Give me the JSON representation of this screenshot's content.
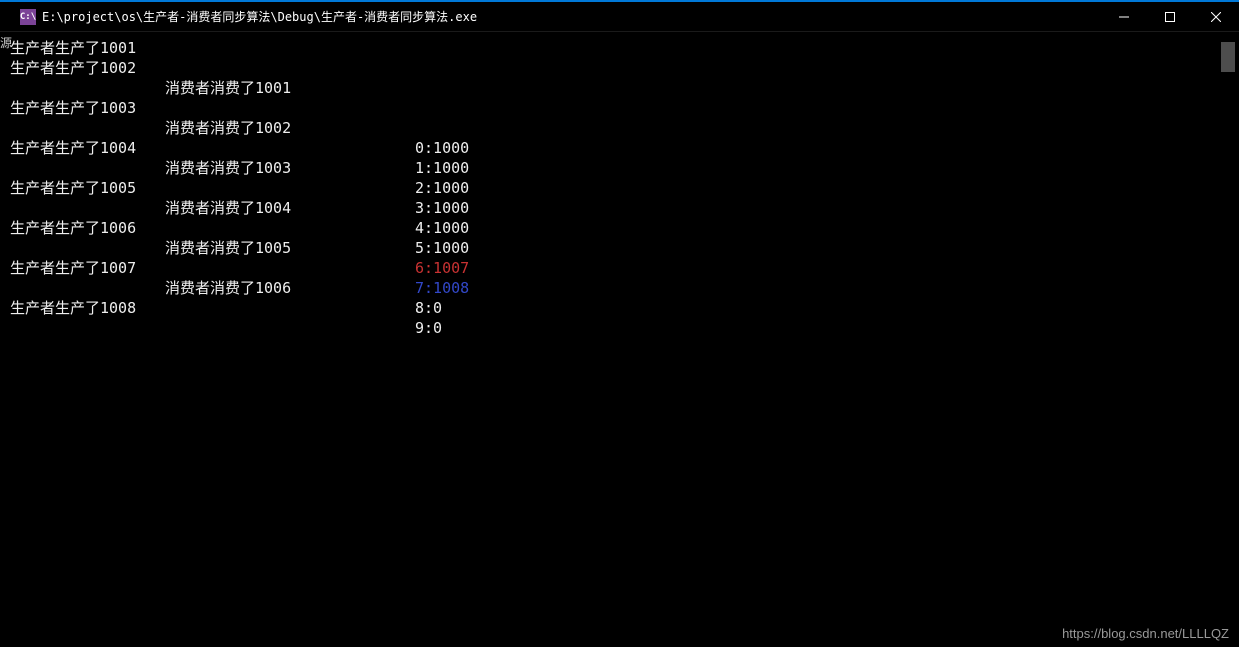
{
  "left_tab": "源",
  "titlebar": {
    "icon_label": "C:\\",
    "title": "E:\\project\\os\\生产者-消费者同步算法\\Debug\\生产者-消费者同步算法.exe"
  },
  "rows": [
    {
      "prod": "生产者生产了1001",
      "cons": "",
      "buf": "",
      "buf_class": ""
    },
    {
      "prod": "生产者生产了1002",
      "cons": "",
      "buf": "",
      "buf_class": ""
    },
    {
      "prod": "",
      "cons": "消费者消费了1001",
      "buf": "",
      "buf_class": ""
    },
    {
      "prod": "生产者生产了1003",
      "cons": "",
      "buf": "",
      "buf_class": ""
    },
    {
      "prod": "",
      "cons": "消费者消费了1002",
      "buf": "",
      "buf_class": ""
    },
    {
      "prod": "生产者生产了1004",
      "cons": "",
      "buf": "0:1000",
      "buf_class": ""
    },
    {
      "prod": "",
      "cons": "消费者消费了1003",
      "buf": "1:1000",
      "buf_class": ""
    },
    {
      "prod": "生产者生产了1005",
      "cons": "",
      "buf": "2:1000",
      "buf_class": ""
    },
    {
      "prod": "",
      "cons": "消费者消费了1004",
      "buf": "3:1000",
      "buf_class": ""
    },
    {
      "prod": "生产者生产了1006",
      "cons": "",
      "buf": "4:1000",
      "buf_class": ""
    },
    {
      "prod": "",
      "cons": "消费者消费了1005",
      "buf": "5:1000",
      "buf_class": ""
    },
    {
      "prod": "生产者生产了1007",
      "cons": "",
      "buf": "6:1007",
      "buf_class": "red"
    },
    {
      "prod": "",
      "cons": "消费者消费了1006",
      "buf": "7:1008",
      "buf_class": "blue"
    },
    {
      "prod": "生产者生产了1008",
      "cons": "",
      "buf": "8:0",
      "buf_class": ""
    },
    {
      "prod": "",
      "cons": "",
      "buf": "9:0",
      "buf_class": ""
    }
  ],
  "watermark": "https://blog.csdn.net/LLLLQZ"
}
